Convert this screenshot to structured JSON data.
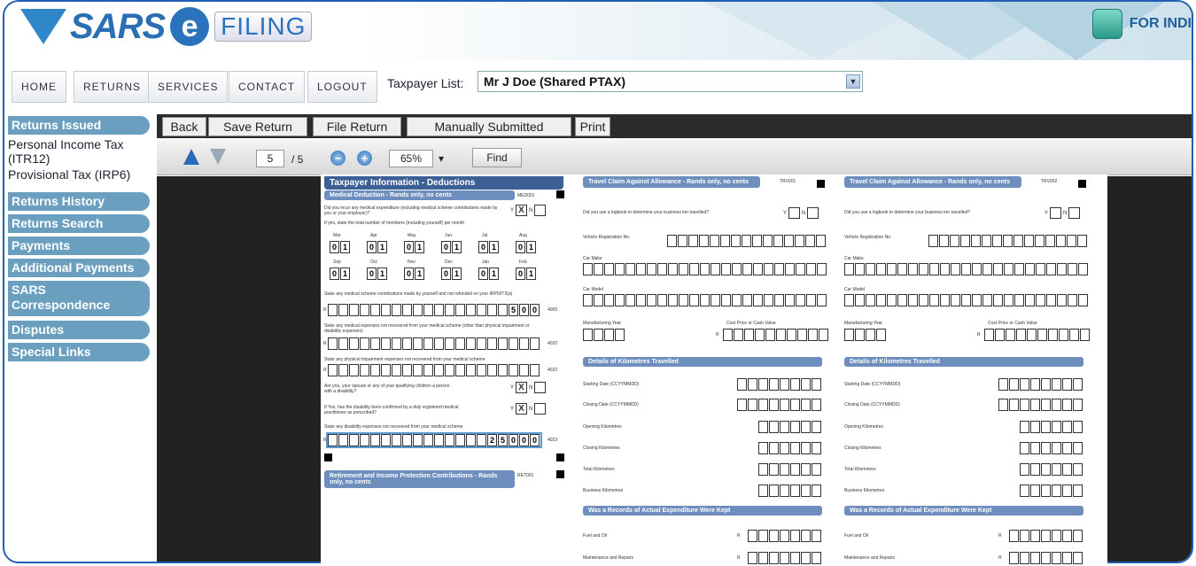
{
  "header": {
    "logo_sars": "SARS",
    "logo_e": "e",
    "logo_filing": "FILING",
    "corner_text": "FOR INDI"
  },
  "nav": {
    "items": [
      "HOME",
      "RETURNS",
      "SERVICES",
      "CONTACT",
      "LOGOUT"
    ],
    "taxpayer_label": "Taxpayer List:",
    "taxpayer_value": "Mr J Doe (Shared PTAX)"
  },
  "sidebar": {
    "returns_issued": "Returns Issued",
    "personal_income_tax": "Personal Income Tax (ITR12)",
    "provisional_tax": "Provisional Tax (IRP6)",
    "returns_history": "Returns History",
    "returns_search": "Returns Search",
    "payments": "Payments",
    "additional_payments": "Additional Payments",
    "sars_correspondence": "SARS Correspondence",
    "disputes": "Disputes",
    "special_links": "Special Links"
  },
  "toolbar": {
    "back": "Back",
    "save": "Save Return",
    "file": "File Return",
    "manual": "Manually Submitted",
    "print": "Print"
  },
  "pdfbar": {
    "page": "5",
    "total": "/ 5",
    "zoom": "65%",
    "find": "Find"
  },
  "form": {
    "title": "Taxpayer Information - Deductions",
    "medical_header": "Medical Deduction - Rands only, no cents",
    "medical_code": "MED001",
    "q_medical": "Did you incur any medical expenditure (including medical scheme contributions made by you or your employer)?",
    "q_members": "If yes, state the total number of members (including yourself) per month",
    "months_row1": [
      "Mar",
      "Apr",
      "May",
      "Jun",
      "Jul",
      "Aug"
    ],
    "months_row2": [
      "Sep",
      "Oct",
      "Nov",
      "Dec",
      "Jan",
      "Feb"
    ],
    "month_value": "01",
    "q_contrib": "State any medical scheme contributions made by yourself and not refunded on your IRP5/IT3(a)",
    "contrib_value": "500",
    "code_4005": "4005",
    "q_expenses": "State any medical expenses not recovered from your medical scheme (other than physical impairment or disability expenses)",
    "code_4020": "4020",
    "q_physical": "State any physical impairment expenses not recovered from your medical scheme",
    "code_4022": "4022",
    "q_disability": "Are you, your spouse or any of your qualifying children a person with a disability?",
    "q_confirmed": "If Yes, has the disability been confirmed by a duly registered medical practitioner as prescribed?",
    "q_disability_exp": "State any disability expenses not recovered from your medical scheme",
    "disability_value": "25000",
    "code_4023": "4023",
    "retirement_header": "Retirement and Income Protection Contributions - Rands only, no cents",
    "retirement_code": "RET001",
    "yes": "Y",
    "no": "N",
    "x": "X",
    "rand_sign": "R",
    "travel_header": "Travel Claim Against Allowance - Rands only, no cents",
    "travel_code_1": "TRV001",
    "travel_code_2": "TRV002",
    "q_logbook": "Did you use a logbook to determine your business km travelled?",
    "vehicle_reg": "Vehicle Registration No.",
    "car_make": "Car Make",
    "car_model": "Car Model",
    "mfg_year": "Manufacturing Year",
    "cost_price": "Cost Price or Cash Value",
    "dist_header": "Details of Kilometres Travelled",
    "start_date": "Starting Date (CCYYMMDD)",
    "close_date": "Closing Date (CCYYMMDD)",
    "open_km": "Opening Kilometres",
    "close_km": "Closing Kilometres",
    "total_km": "Total Kilometres",
    "business_km": "Business Kilometres",
    "actual_header": "Was a Records of Actual Expenditure Were Kept",
    "fuel": "Fuel and Oil",
    "maintenance": "Maintenance and Repairs"
  }
}
